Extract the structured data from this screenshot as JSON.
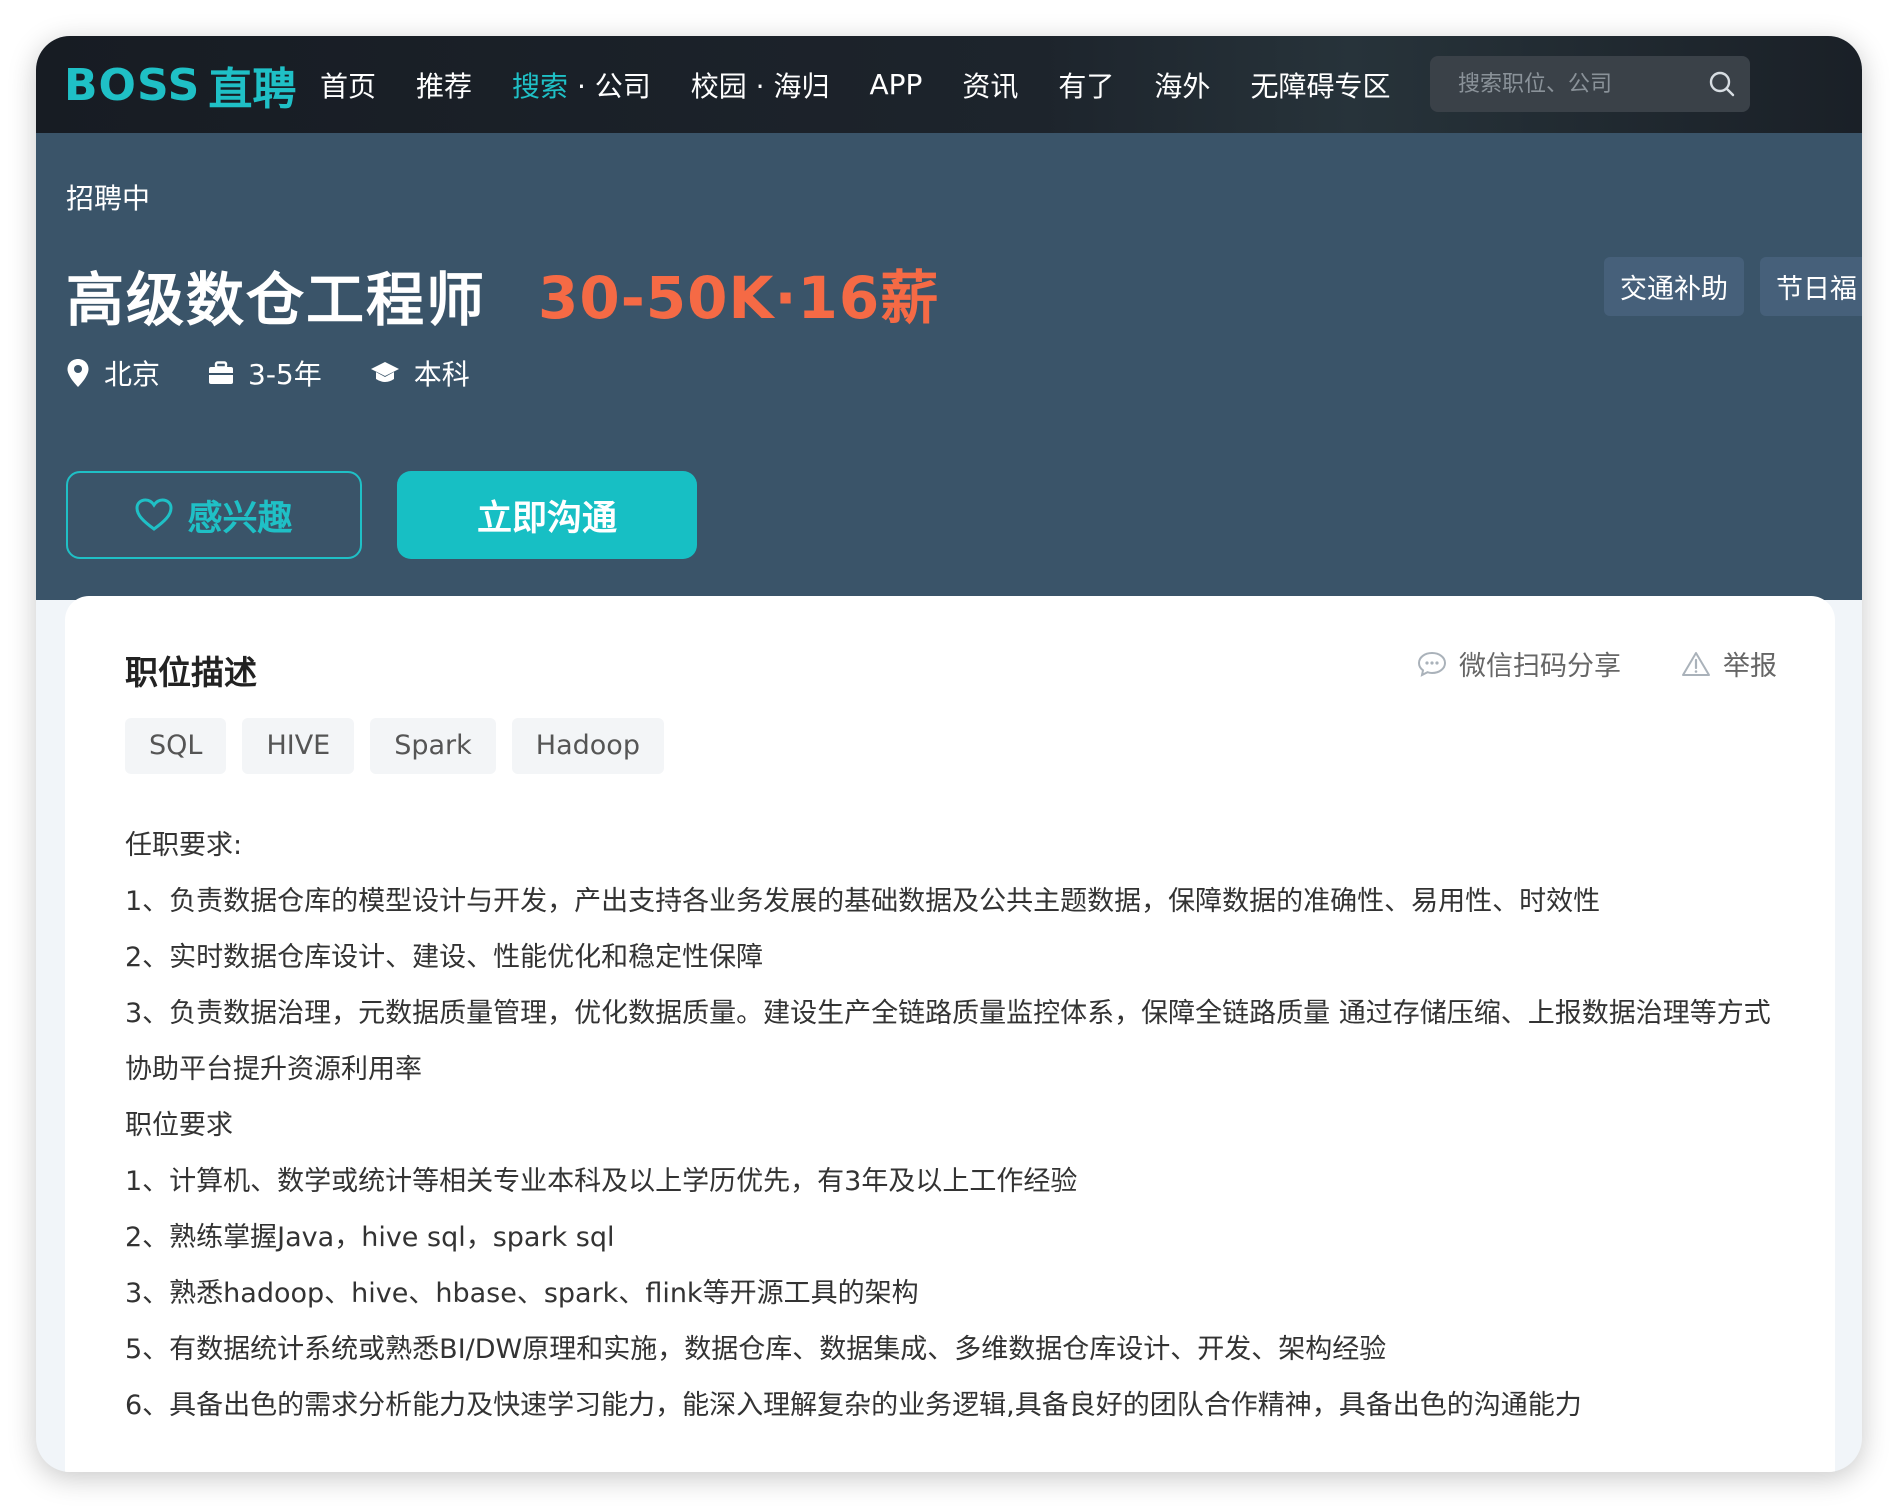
{
  "nav": {
    "logo_latin": "BOSS",
    "logo_cn": "直聘",
    "items": [
      {
        "label": "首页"
      },
      {
        "label": "推荐"
      },
      {
        "label_highlight": "搜索",
        "label_rest": " · 公司"
      },
      {
        "label": "校园 · 海归"
      },
      {
        "label": "APP"
      },
      {
        "label": "资讯"
      },
      {
        "label": "有了"
      },
      {
        "label": "海外"
      },
      {
        "label": "无障碍专区"
      }
    ],
    "search_placeholder": "搜索职位、公司",
    "accent_color": "#1fc0c6"
  },
  "job": {
    "status": "招聘中",
    "title": "高级数仓工程师",
    "salary": "30-50K·16薪",
    "salary_color": "#f56a45",
    "benefits": [
      "交通补助",
      "节日福"
    ],
    "location": "北京",
    "experience": "3-5年",
    "education": "本科",
    "interest_button": "感兴趣",
    "chat_button": "立即沟通"
  },
  "description": {
    "section_title": "职位描述",
    "share_label": "微信扫码分享",
    "report_label": "举报",
    "tags": [
      "SQL",
      "HIVE",
      "Spark",
      "Hadoop"
    ],
    "lines": [
      "任职要求:",
      "1、负责数据仓库的模型设计与开发，产出支持各业务发展的基础数据及公共主题数据，保障数据的准确性、易用性、时效性",
      "2、实时数据仓库设计、建设、性能优化和稳定性保障",
      "3、负责数据治理，元数据质量管理，优化数据质量。建设生产全链路质量监控体系，保障全链路质量 通过存储压缩、上报数据治理等方式协助平台提升资源利用率",
      "职位要求",
      "1、计算机、数学或统计等相关专业本科及以上学历优先，有3年及以上工作经验",
      "2、熟练掌握Java，hive sql，spark sql",
      "3、熟悉hadoop、hive、hbase、spark、flink等开源工具的架构",
      "5、有数据统计系统或熟悉BI/DW原理和实施，数据仓库、数据集成、多维数据仓库设计、开发、架构经验",
      "6、具备出色的需求分析能力及快速学习能力，能深入理解复杂的业务逻辑,具备良好的团队合作精神，具备出色的沟通能力"
    ]
  }
}
